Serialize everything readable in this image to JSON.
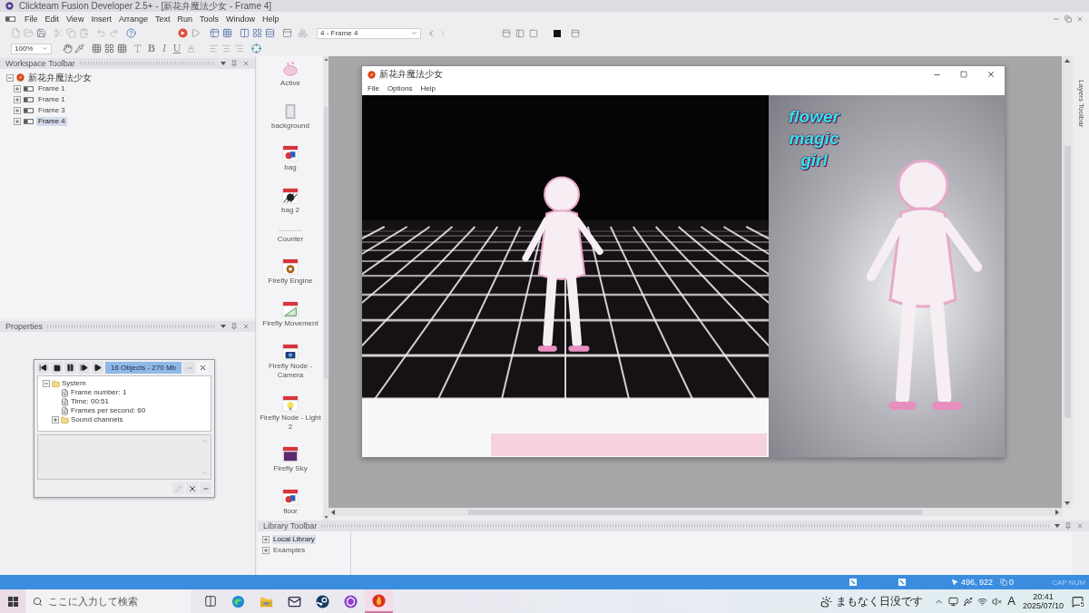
{
  "window": {
    "title": "Clickteam Fusion Developer 2.5+ - [新花弁魔法少女 - Frame 4]"
  },
  "menu_bar": [
    "File",
    "Edit",
    "View",
    "Insert",
    "Arrange",
    "Text",
    "Run",
    "Tools",
    "Window",
    "Help"
  ],
  "toolbar": {
    "frame_select": "4 - Frame 4",
    "zoom_select": "100%",
    "text_style_buttons": [
      {
        "label": "B",
        "kind": "bold"
      },
      {
        "label": "I",
        "kind": "italic"
      },
      {
        "label": "U",
        "kind": "underline"
      }
    ]
  },
  "workspace_toolbar": {
    "title": "Workspace Toolbar",
    "tree": [
      {
        "label": "新花弁魔法少女",
        "expanded": true,
        "selected": false,
        "children": [
          {
            "label": "Frame 1",
            "expanded": false,
            "selected": false
          },
          {
            "label": "Frame 1",
            "expanded": false,
            "selected": false
          },
          {
            "label": "Frame 3",
            "expanded": false,
            "selected": false
          },
          {
            "label": "Frame 4",
            "expanded": false,
            "selected": true
          }
        ]
      }
    ]
  },
  "properties": {
    "title": "Properties"
  },
  "debugger": {
    "status": "16 Objects - 270 Mb",
    "tree": [
      {
        "label": "System",
        "kind": "folder",
        "expanded": true,
        "children": [
          {
            "label": "Frame number: 1",
            "kind": "value"
          },
          {
            "label": "Time: 00:51",
            "kind": "value"
          },
          {
            "label": "Frames per second: 60",
            "kind": "value"
          },
          {
            "label": "Sound channels",
            "kind": "folder",
            "expanded": false
          }
        ]
      }
    ]
  },
  "objects": [
    {
      "name": "Active",
      "kind": "active"
    },
    {
      "name": "background",
      "kind": "backdrop"
    },
    {
      "name": "bag",
      "kind": "shapes"
    },
    {
      "name": "bag 2",
      "kind": "sphere"
    },
    {
      "name": "Counter",
      "kind": "counter"
    },
    {
      "name": "Firefly Engine",
      "kind": "engine"
    },
    {
      "name": "Firefly Movement",
      "kind": "movement"
    },
    {
      "name": "Firefly Node - Camera",
      "kind": "camera"
    },
    {
      "name": "Firefly Node - Light 2",
      "kind": "light"
    },
    {
      "name": "Firefly Sky",
      "kind": "sky"
    },
    {
      "name": "floor",
      "kind": "shapes"
    }
  ],
  "game_window": {
    "title": "新花弁魔法少女",
    "menu": [
      "File",
      "Options",
      "Help"
    ],
    "title_art": "flower magic girl"
  },
  "layers_toolbar": {
    "title": "Layers Toolbar"
  },
  "library_toolbar": {
    "title": "Library Toolbar",
    "tree": [
      {
        "label": "Local Library",
        "expanded": false,
        "selected": true
      },
      {
        "label": "Examples",
        "expanded": false,
        "selected": false
      }
    ]
  },
  "status_bar": {
    "coordinates": "496, 922",
    "object_count": "0",
    "keys": "CAP NUM"
  },
  "taskbar": {
    "search": {
      "placeholder": "ここに入力して検索"
    },
    "apps": [
      {
        "kind": "task-view",
        "active": false
      },
      {
        "kind": "browser",
        "active": false
      },
      {
        "kind": "explorer",
        "active": false
      },
      {
        "kind": "mail",
        "active": false
      },
      {
        "kind": "launcher",
        "active": false
      },
      {
        "kind": "toolkit",
        "active": false
      },
      {
        "kind": "editor",
        "active": true
      }
    ],
    "weather": "まもなく日没です",
    "ime": "A",
    "time": "20:41",
    "date": "2025/07/10",
    "notifications": "5"
  }
}
